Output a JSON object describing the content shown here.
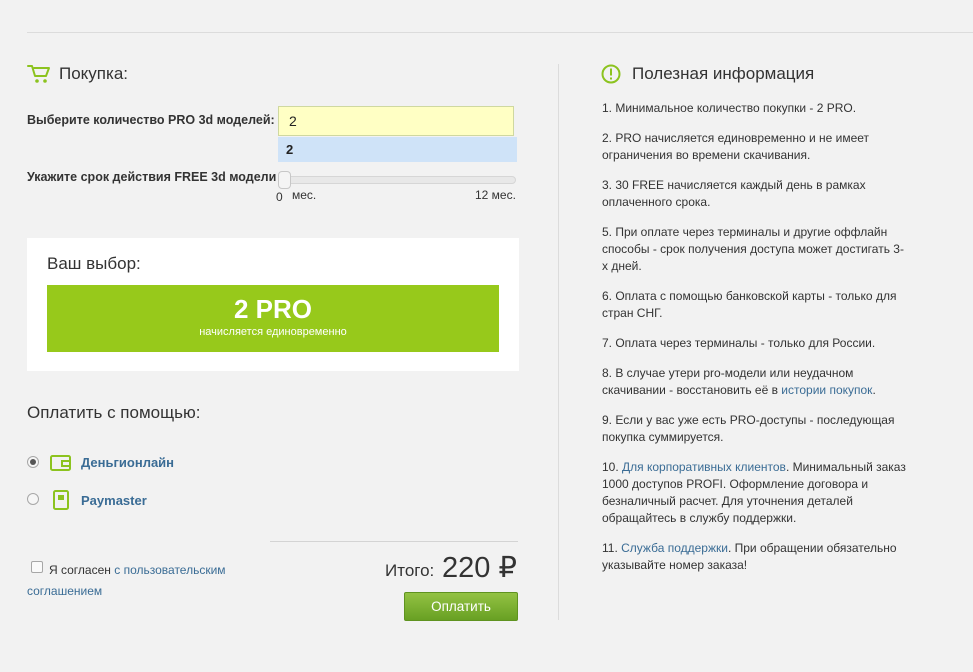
{
  "purchase": {
    "title": "Покупка:",
    "quantity_label": "Выберите количество PRO 3d моделей:",
    "quantity_value": "2",
    "quantity_suggestion": "2",
    "term_label": "Укажите срок действия FREE 3d модели",
    "slider": {
      "min_label": "0",
      "unit_label": "мес.",
      "max_label": "12 мес.",
      "value_months": 0
    }
  },
  "choice": {
    "title": "Ваш выбор:",
    "main": "2 PRO",
    "sub": "начисляется единовременно"
  },
  "payment": {
    "title": "Оплатить с помощью:",
    "methods": [
      {
        "label": "Деньгионлайн",
        "icon": "wallet-icon",
        "selected": true
      },
      {
        "label": "Paymaster",
        "icon": "paymaster-icon",
        "selected": false
      }
    ]
  },
  "agreement": {
    "text": "Я согласен",
    "link": "с пользовательским соглашением",
    "checked": false
  },
  "total": {
    "label": "Итого:",
    "value": "220 ₽"
  },
  "pay_button": "Оплатить",
  "info": {
    "title": "Полезная информация",
    "items": [
      {
        "text": "1. Минимальное количество покупки - 2 PRO."
      },
      {
        "text": "2. PRO начисляется единовременно и не имеет ограничения во времени скачивания."
      },
      {
        "text": "3. 30 FREE начисляется каждый день в рамках оплаченного срока."
      },
      {
        "text": "5. При оплате через терминалы и другие оффлайн способы - срок получения доступа может достигать 3-х дней."
      },
      {
        "text": "6. Оплата с помощью банковской карты - только для стран СНГ."
      },
      {
        "text": "7. Оплата через терминалы - только для России."
      },
      {
        "pre": "8. В случае утери pro-модели или неудачном скачивании - восстановить её в ",
        "link": "истории покупок",
        "post": "."
      },
      {
        "text": "9. Если у вас уже есть PRO-доступы - последующая покупка суммируется."
      },
      {
        "pre": "10. ",
        "link": "Для корпоративных клиентов",
        "post": ". Минимальный заказ 1000 доступов PROFI. Оформление договора и безналичный расчет. Для уточнения деталей обращайтесь в службу поддержки."
      },
      {
        "pre": "11. ",
        "link": "Служба поддержки",
        "post": ". При обращении обязательно указывайте номер заказа!"
      }
    ]
  },
  "colors": {
    "accent_green": "#97c91b",
    "link_blue": "#3a6c95",
    "input_yellow": "#ffffc4",
    "button_green": "#68a023"
  }
}
